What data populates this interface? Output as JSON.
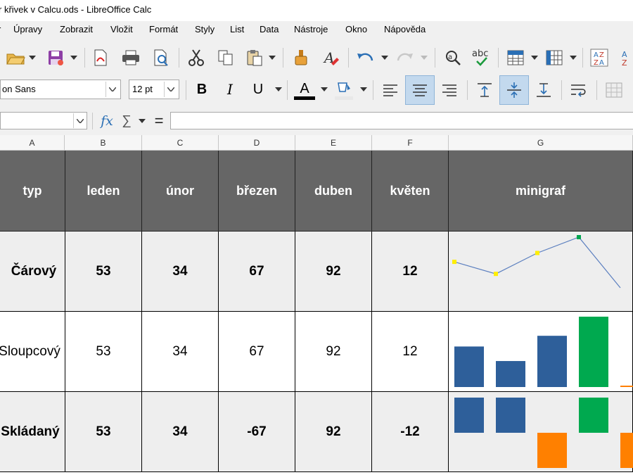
{
  "window": {
    "title": "r křivek v Calcu.ods - LibreOffice Calc"
  },
  "menu": [
    "Úpravy",
    "Zobrazit",
    "Vložit",
    "Formát",
    "Styly",
    "List",
    "Data",
    "Nástroje",
    "Okno",
    "Nápověda"
  ],
  "toolbar": {
    "font_name": "on Sans",
    "font_size": "12 pt",
    "bold": "B",
    "italic": "I",
    "underline": "U",
    "font_color_letter": "A",
    "spell_label": "abc",
    "sort_label_a": "A",
    "sort_label_z": "Z"
  },
  "formula_bar": {
    "fx": "fx",
    "sum": "∑",
    "equals": "=",
    "value": ""
  },
  "columns": [
    "A",
    "B",
    "C",
    "D",
    "E",
    "F",
    "G"
  ],
  "sheet": {
    "headers": [
      "typ",
      "leden",
      "únor",
      "březen",
      "duben",
      "květen",
      "minigraf"
    ],
    "rows": [
      {
        "label": "Čárový",
        "values": [
          "53",
          "34",
          "67",
          "92",
          "12"
        ]
      },
      {
        "label": "Sloupcový",
        "values": [
          "53",
          "34",
          "67",
          "92",
          "12"
        ]
      },
      {
        "label": "Skládaný",
        "values": [
          "53",
          "34",
          "-67",
          "92",
          "-12"
        ]
      }
    ]
  },
  "sparklines": {
    "line": {
      "values": [
        53,
        34,
        67,
        92,
        12
      ],
      "color": "#5b7fbf",
      "marker": "#ffee00",
      "high_marker": "#00a651"
    },
    "column": {
      "values": [
        53,
        34,
        67,
        92,
        12
      ],
      "color": "#2e5f9a",
      "high_color": "#00a94f",
      "low_color": "#ff8000"
    },
    "stacked": {
      "values": [
        53,
        34,
        -67,
        92,
        -12
      ],
      "color": "#2e5f9a",
      "high_color": "#00a94f",
      "negative_color": "#ff8000"
    }
  }
}
